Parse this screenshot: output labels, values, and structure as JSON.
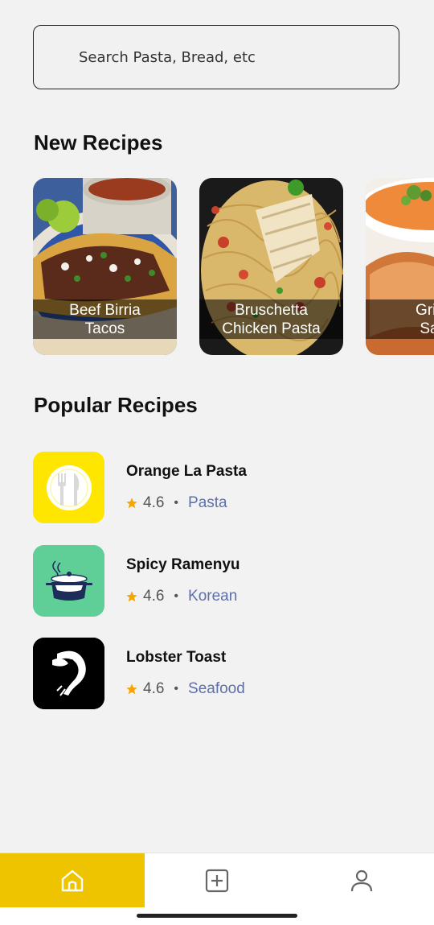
{
  "search": {
    "placeholder": "Search Pasta, Bread, etc"
  },
  "new_recipes": {
    "title": "New Recipes",
    "cards": [
      {
        "label": "Beef Birria\nTacos",
        "image": "tacos-photo"
      },
      {
        "label": "Bruschetta\nChicken Pasta",
        "image": "pasta-photo"
      },
      {
        "label": "Grilled\nSand",
        "image": "toast-soup-photo"
      }
    ]
  },
  "popular_recipes": {
    "title": "Popular Recipes",
    "items": [
      {
        "name": "Orange La Pasta",
        "rating": "4.6",
        "category": "Pasta",
        "icon": "fork-knife-plate-icon",
        "color": "#ffe600"
      },
      {
        "name": "Spicy Ramenyu",
        "rating": "4.6",
        "category": "Korean",
        "icon": "steaming-pot-icon",
        "color": "#5fcf97"
      },
      {
        "name": "Lobster Toast",
        "rating": "4.6",
        "category": "Seafood",
        "icon": "lobster-logo-icon",
        "color": "#000000"
      }
    ]
  },
  "nav": {
    "items": [
      {
        "name": "home",
        "icon": "home-icon",
        "active": true
      },
      {
        "name": "add",
        "icon": "add-square-icon",
        "active": false
      },
      {
        "name": "profile",
        "icon": "user-icon",
        "active": false
      }
    ]
  },
  "colors": {
    "accent": "#eec400",
    "star": "#f5a500",
    "category": "#5f6fa8"
  }
}
